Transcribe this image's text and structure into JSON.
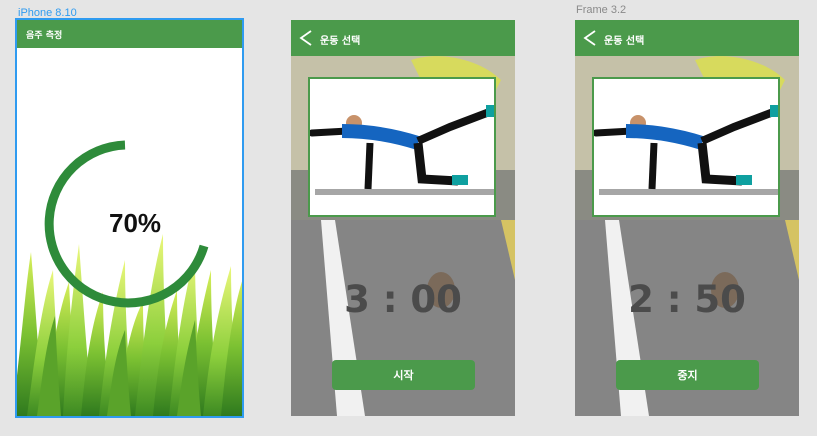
{
  "canvas_labels": {
    "frame1": "iPhone 8.10",
    "frame3": "Frame 3.2"
  },
  "screens": [
    {
      "header_title": "음주 측정",
      "progress_text": "70%",
      "progress_value": 0.7
    },
    {
      "header_title": "운동 선택",
      "timer": "3 : 00",
      "button_label": "시작"
    },
    {
      "header_title": "운동 선택",
      "timer": "2 : 50",
      "button_label": "중지"
    }
  ],
  "colors": {
    "brand_green": "#4b9a4b",
    "ring_green": "#2e8b3a",
    "selection_blue": "#2f9bf0",
    "label_blue": "#2f9bf0",
    "label_gray": "#8a8a8a",
    "timer_gray": "#4b4b4b"
  }
}
